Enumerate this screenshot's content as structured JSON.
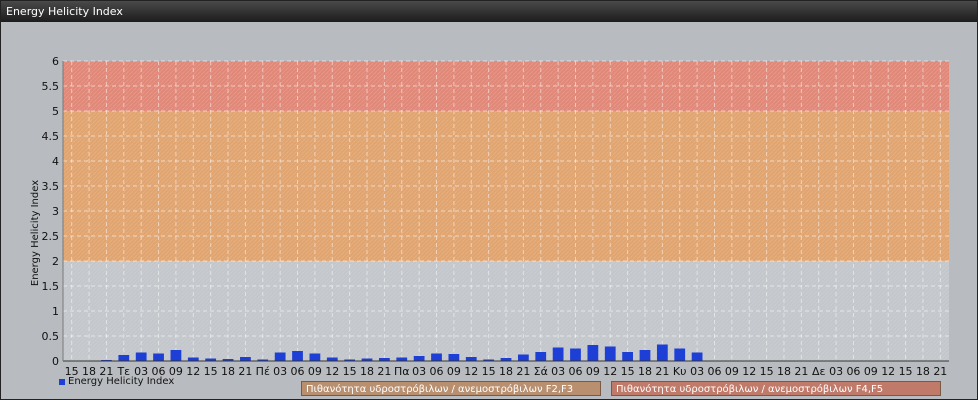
{
  "window": {
    "title": "Energy Helicity Index"
  },
  "legend": {
    "series_label": "Energy Helicity Index",
    "band_f2f3": "Πιθανότητα υδροστρόβιλων / ανεμοστρόβιλων F2,F3",
    "band_f4f5": "Πιθανότητα υδροστρόβιλων / ανεμοστρόβιλων F4,F5"
  },
  "chart_data": {
    "type": "bar",
    "title": "",
    "ylabel": "Energy Helicity Index",
    "xlabel": "",
    "ylim": [
      0,
      6
    ],
    "yticks": [
      0,
      0.5,
      1,
      1.5,
      2,
      2.5,
      3,
      3.5,
      4,
      4.5,
      5,
      5.5,
      6
    ],
    "grid": true,
    "bands": [
      {
        "from": 2,
        "to": 5,
        "color": "#e0a470"
      },
      {
        "from": 5,
        "to": 6,
        "color": "#e08878"
      }
    ],
    "categories": [
      "15",
      "18",
      "21",
      "Τε",
      "03",
      "06",
      "09",
      "12",
      "15",
      "18",
      "21",
      "Πέ",
      "03",
      "06",
      "09",
      "12",
      "15",
      "18",
      "21",
      "Πα",
      "03",
      "06",
      "09",
      "12",
      "15",
      "18",
      "21",
      "Σά",
      "03",
      "06",
      "09",
      "12",
      "15",
      "18",
      "21",
      "Κυ",
      "03",
      "06",
      "09",
      "12",
      "15",
      "18",
      "21",
      "Δε",
      "03",
      "06",
      "09",
      "12",
      "15",
      "18",
      "21"
    ],
    "series": [
      {
        "name": "Energy Helicity Index",
        "color": "#1d3fd6",
        "values": [
          0.01,
          0.01,
          0.02,
          0.12,
          0.17,
          0.15,
          0.22,
          0.07,
          0.05,
          0.04,
          0.08,
          0.03,
          0.17,
          0.2,
          0.15,
          0.07,
          0.03,
          0.05,
          0.06,
          0.07,
          0.1,
          0.15,
          0.14,
          0.08,
          0.03,
          0.06,
          0.13,
          0.18,
          0.27,
          0.25,
          0.32,
          0.29,
          0.18,
          0.22,
          0.33,
          0.25,
          0.17,
          0.01,
          0.01,
          0.01,
          0.01,
          0.01,
          0.01,
          0.01,
          0.01,
          0.01,
          0.01,
          0.01,
          0.01,
          0.01,
          0.01
        ]
      }
    ]
  }
}
